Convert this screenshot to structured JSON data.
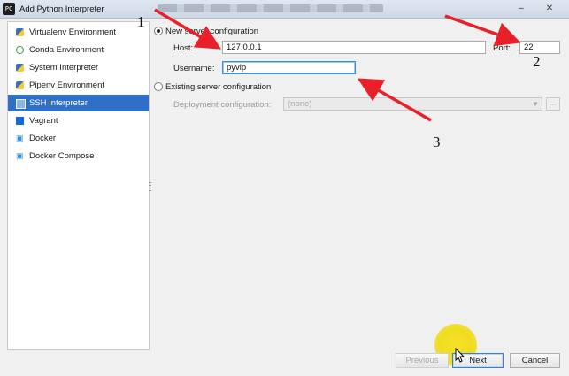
{
  "window": {
    "title": "Add Python Interpreter",
    "app_icon_text": "PC"
  },
  "sidebar": {
    "items": [
      {
        "label": "Virtualenv Environment",
        "icon": "python-icon",
        "selected": false
      },
      {
        "label": "Conda Environment",
        "icon": "conda-icon",
        "selected": false
      },
      {
        "label": "System Interpreter",
        "icon": "python-icon",
        "selected": false
      },
      {
        "label": "Pipenv Environment",
        "icon": "pipenv-icon",
        "selected": false
      },
      {
        "label": "SSH Interpreter",
        "icon": "ssh-icon",
        "selected": true
      },
      {
        "label": "Vagrant",
        "icon": "vagrant-icon",
        "selected": false
      },
      {
        "label": "Docker",
        "icon": "docker-icon",
        "selected": false
      },
      {
        "label": "Docker Compose",
        "icon": "docker-icon",
        "selected": false
      }
    ]
  },
  "form": {
    "new_server_label": "New server configuration",
    "host_label": "Host:",
    "host_value": "127.0.0.1",
    "port_label": "Port:",
    "port_value": "22",
    "username_label": "Username:",
    "username_value": "pyvip",
    "existing_server_label": "Existing server configuration",
    "deployment_label": "Deployment configuration:",
    "deployment_value": "(none)",
    "dots_label": "..."
  },
  "annotations": {
    "n1": "1",
    "n2": "2",
    "n3": "3",
    "color": "#e8202a"
  },
  "buttons": {
    "previous": "Previous",
    "next": "Next",
    "cancel": "Cancel"
  }
}
